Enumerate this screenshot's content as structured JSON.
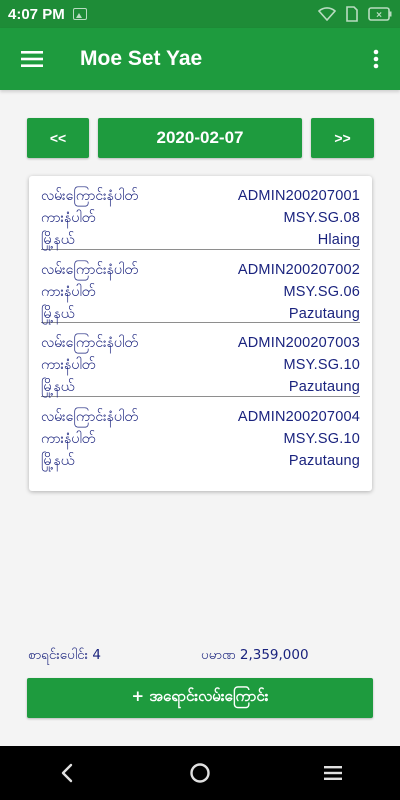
{
  "status_bar": {
    "time": "4:07 PM",
    "battery_label": "×",
    "icons": [
      "image-icon",
      "wifi-icon",
      "sim-icon",
      "battery-icon"
    ]
  },
  "app_bar": {
    "title": "Moe Set Yae",
    "menu_icon": "hamburger-menu-icon",
    "more_icon": "more-vertical-icon"
  },
  "date_nav": {
    "prev_label": "<<",
    "date": "2020-02-07",
    "next_label": ">>"
  },
  "items": [
    {
      "route_label": "လမ်းကြောင်းနံပါတ်",
      "route_value": "ADMIN200207001",
      "car_label": "ကားနံပါတ်",
      "car_value": "MSY.SG.08",
      "town_label": "မြို့နယ်",
      "town_value": "Hlaing"
    },
    {
      "route_label": "လမ်းကြောင်းနံပါတ်",
      "route_value": "ADMIN200207002",
      "car_label": "ကားနံပါတ်",
      "car_value": "MSY.SG.06",
      "town_label": "မြို့နယ်",
      "town_value": "Pazutaung"
    },
    {
      "route_label": "လမ်းကြောင်းနံပါတ်",
      "route_value": "ADMIN200207003",
      "car_label": "ကားနံပါတ်",
      "car_value": "MSY.SG.10",
      "town_label": "မြို့နယ်",
      "town_value": "Pazutaung"
    },
    {
      "route_label": "လမ်းကြောင်းနံပါတ်",
      "route_value": "ADMIN200207004",
      "car_label": "ကားနံပါတ်",
      "car_value": "MSY.SG.10",
      "town_label": "မြို့နယ်",
      "town_value": "Pazutaung"
    }
  ],
  "summary": {
    "count_text": "စာရင်းပေါင်း 4",
    "amount_text": "ပမာဏ 2,359,000"
  },
  "add_button": {
    "label": "+ အရောင်းလမ်းကြောင်း"
  },
  "system_nav": {
    "icons": [
      "back-icon",
      "home-icon",
      "recents-icon"
    ]
  },
  "colors": {
    "primary": "#1e9b3e",
    "status_bar": "#1e8c37",
    "text_primary": "#1a237e",
    "background": "#f4f4f4"
  }
}
